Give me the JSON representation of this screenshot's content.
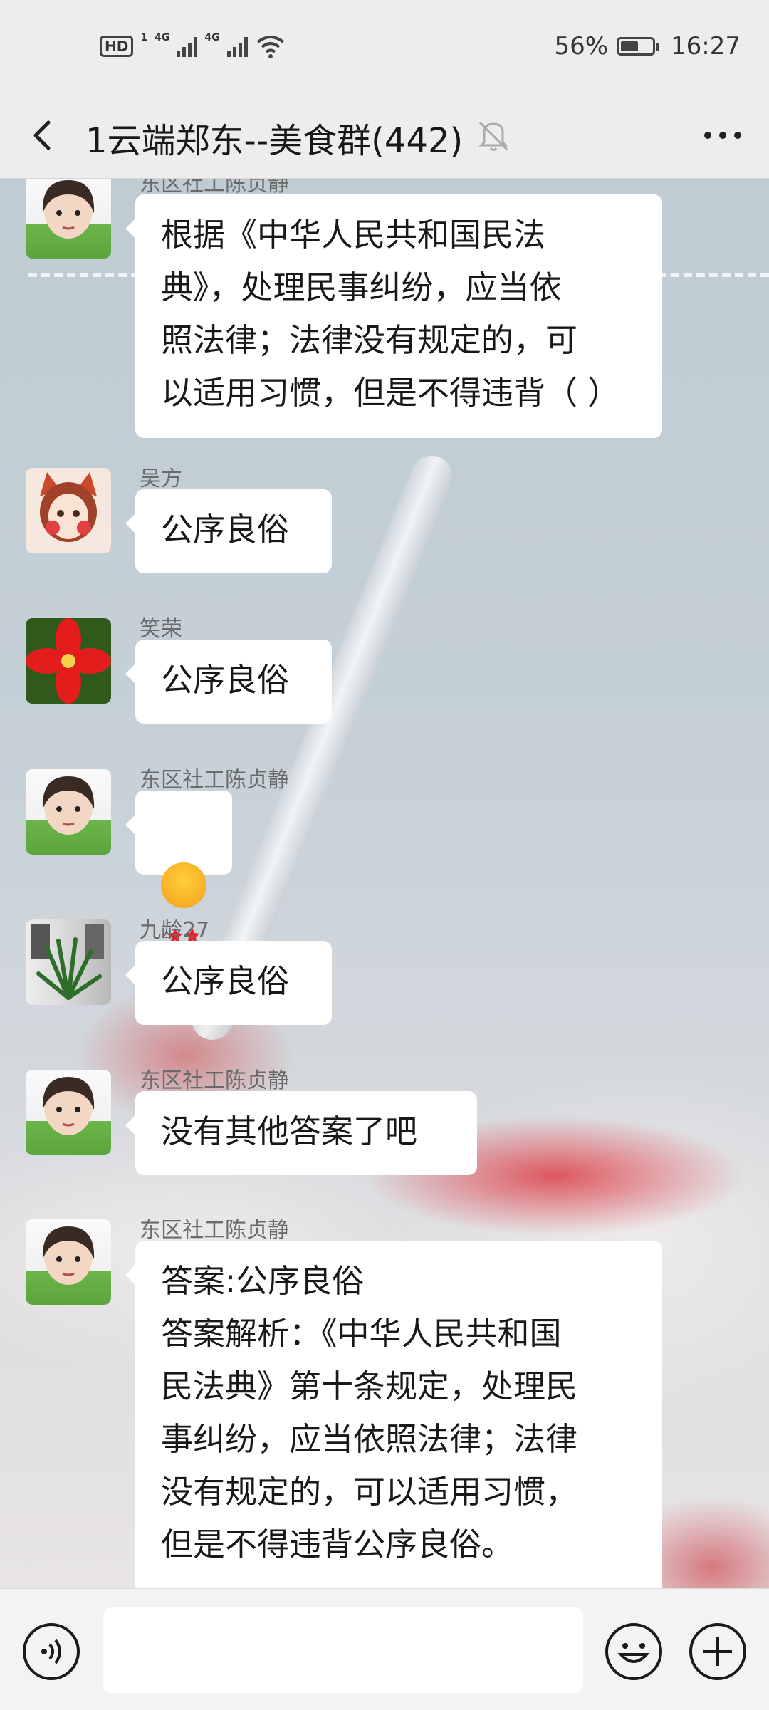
{
  "status_bar": {
    "hd": "HD",
    "sim": "1",
    "network1": "4G",
    "network2": "4G",
    "battery_text": "56%",
    "battery_level": 0.56,
    "time": "16:27"
  },
  "header": {
    "title": "1云端郑东--美食群(442)",
    "icons": [
      "back-icon",
      "mute-bell-icon",
      "more-icon"
    ]
  },
  "messages": [
    {
      "sender": "东区社工陈贞静",
      "text": "根据《中华人民共和国民法\n典》，处理民事纠纷，应当依\n照法律；法律没有规定的，可\n以适用习惯，但是不得违背（ ）"
    },
    {
      "sender": "吴方",
      "text": "公序良俗"
    },
    {
      "sender": "笑荣",
      "text": "公序良俗"
    },
    {
      "sender": "东区社工陈贞静",
      "text": "",
      "emoji": "star-struck-emoji"
    },
    {
      "sender": "九龄27",
      "text": "公序良俗"
    },
    {
      "sender": "东区社工陈贞静",
      "text": "没有其他答案了吧"
    },
    {
      "sender": "东区社工陈贞静",
      "text": "答案:公序良俗\n答案解析：《中华人民共和国\n民法典》第十条规定，处理民\n事纠纷，应当依照法律；法律\n没有规定的，可以适用习惯，\n但是不得违背公序良俗。"
    }
  ],
  "input_bar": {
    "input_value": "",
    "icons": [
      "voice-icon",
      "emoji-icon",
      "plus-icon"
    ]
  }
}
